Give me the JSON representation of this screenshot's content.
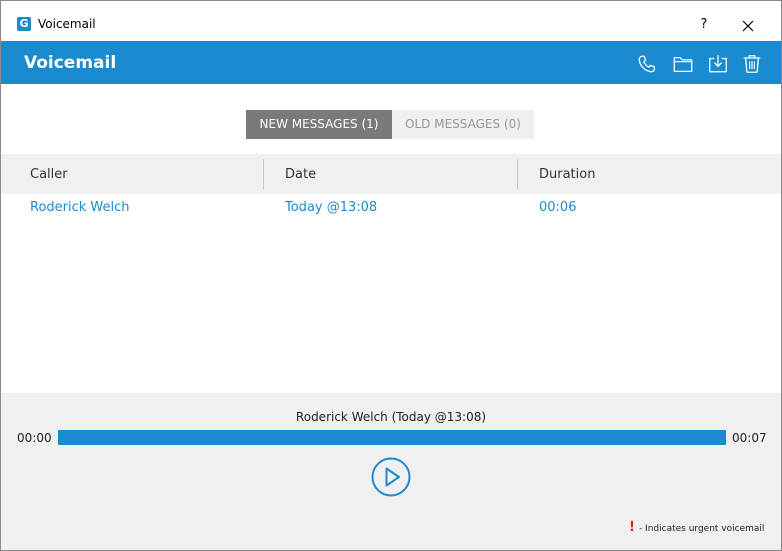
{
  "window": {
    "title": "Voicemail",
    "app_icon_letter": "G",
    "help_label": "?",
    "close_label": "✕"
  },
  "header": {
    "title": "Voicemail",
    "icons": [
      "phone-icon",
      "folder-icon",
      "download-icon",
      "trash-icon"
    ]
  },
  "tabs": [
    {
      "label": "NEW MESSAGES (1)",
      "active": true
    },
    {
      "label": "OLD MESSAGES (0)",
      "active": false
    }
  ],
  "table": {
    "columns": [
      "Caller",
      "Date",
      "Duration"
    ],
    "rows": [
      {
        "caller": "Roderick Welch",
        "date": "Today @13:08",
        "duration": "00:06"
      }
    ]
  },
  "player": {
    "now_playing": "Roderick Welch (Today @13:08)",
    "time_start": "00:00",
    "time_end": "00:07",
    "progress_fraction": 1.0,
    "play_icon": "play-icon"
  },
  "legend": {
    "mark": "!",
    "text": "- Indicates urgent voicemail"
  },
  "colors": {
    "accent": "#1a8bcf",
    "urgent": "#e02020"
  }
}
